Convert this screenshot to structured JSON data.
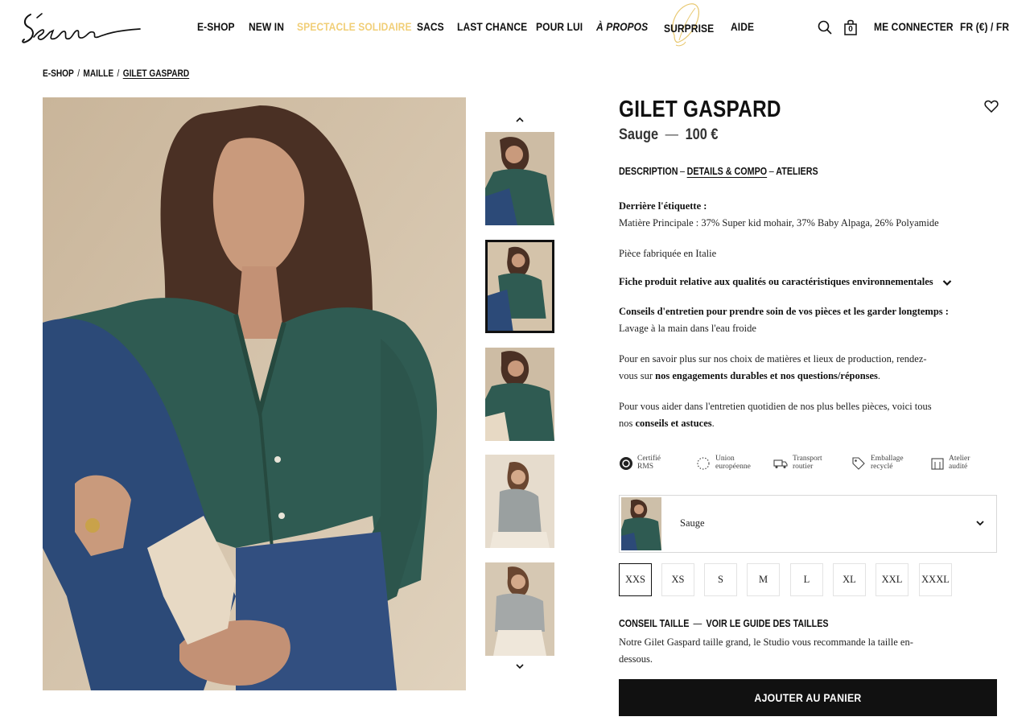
{
  "brand": {
    "logo_text": "Sézane"
  },
  "nav": {
    "items": [
      {
        "label": "E-SHOP"
      },
      {
        "label": "NEW IN"
      },
      {
        "label": "SPECTACLE SOLIDAIRE"
      },
      {
        "label": "SACS"
      },
      {
        "label": "LAST CHANCE"
      },
      {
        "label": "POUR LUI"
      },
      {
        "label": "À PROPOS"
      },
      {
        "label": "SURPRISE"
      },
      {
        "label": "AIDE"
      }
    ],
    "cart_count": "0",
    "login": "ME CONNECTER",
    "locale": "FR (€) / FR",
    "accent_color": "#f1cf79"
  },
  "breadcrumb": [
    "E-SHOP",
    "MAILLE",
    "GILET GASPARD"
  ],
  "product": {
    "title": "GILET GASPARD",
    "color": "Sauge",
    "price": "100 €",
    "tabs": [
      "DESCRIPTION",
      "DETAILS & COMPO",
      "ATELIERS"
    ],
    "active_tab": "DETAILS & COMPO",
    "label_heading": "Derrière l'étiquette :",
    "material": "Matière Principale : 37% Super kid mohair, 37% Baby Alpaga, 26% Polyamide",
    "made_in": "Pièce fabriquée en Italie",
    "env_sheet": "Fiche produit relative aux qualités ou caractéristiques environnementales",
    "care_heading": "Conseils d'entretien pour prendre soin de vos pièces et les garder longtemps :",
    "care_text": "Lavage à la main dans l'eau froide",
    "info1_a": "Pour en savoir plus sur nos choix de matières et lieux de production, rendez-",
    "info1_b": "vous sur ",
    "info1_bold": "nos engagements durables et nos questions/réponses",
    "info1_end": ".",
    "info2_a": "Pour vous aider dans l'entretien quotidien de nos plus belles pièces, voici tous",
    "info2_b": "nos ",
    "info2_bold": "conseils et astuces",
    "info2_end": ".",
    "badges": [
      {
        "line1": "Certifié",
        "line2": "RMS",
        "icon": "rms-icon"
      },
      {
        "line1": "Union",
        "line2": "européenne",
        "icon": "eu-icon"
      },
      {
        "line1": "Transport",
        "line2": "routier",
        "icon": "truck-icon"
      },
      {
        "line1": "Emballage",
        "line2": "recyclé",
        "icon": "tag-icon"
      },
      {
        "line1": "Atelier",
        "line2": "audité",
        "icon": "building-icon"
      }
    ],
    "selected_color": "Sauge",
    "sizes": [
      "XXS",
      "XS",
      "S",
      "M",
      "L",
      "XL",
      "XXL",
      "XXXL"
    ],
    "selected_size": "XXS",
    "size_advice_label": "CONSEIL TAILLE",
    "size_guide_link": "VOIR LE GUIDE DES TAILLES",
    "size_advice_text": "Notre Gilet Gaspard taille grand, le Studio vous recommande la taille en-",
    "size_advice_text2": "dessous.",
    "add_to_cart": "AJOUTER AU PANIER",
    "cardigan_color": "#2f5b52",
    "jeans_color": "#2c4a78"
  }
}
